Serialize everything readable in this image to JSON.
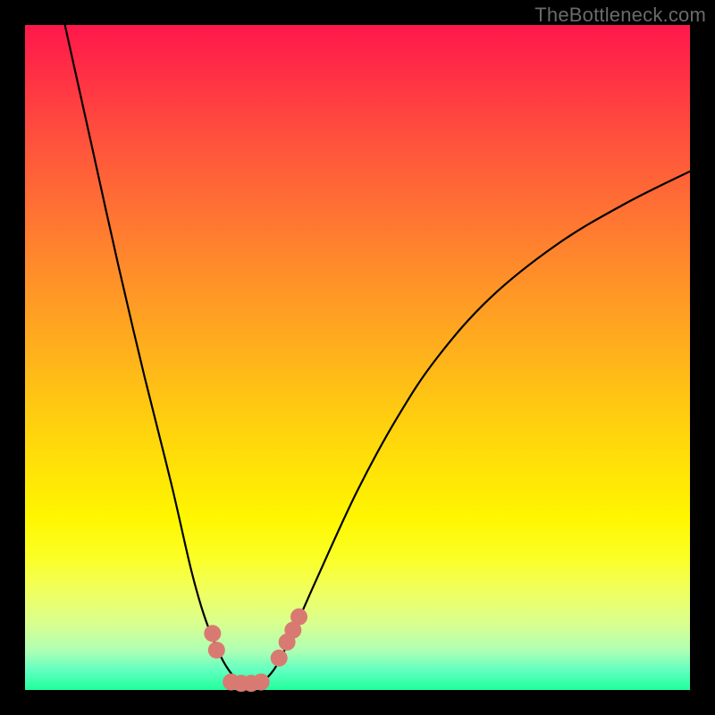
{
  "watermark": {
    "text": "TheBottleneck.com"
  },
  "colors": {
    "frame": "#000000",
    "curve": "#000000",
    "marker": "#d97a72",
    "gradient_top": "#ff184b",
    "gradient_bottom": "#21ff9c"
  },
  "chart_data": {
    "type": "line",
    "title": "",
    "xlabel": "",
    "ylabel": "",
    "xlim": [
      0,
      100
    ],
    "ylim": [
      0,
      100
    ],
    "x": [
      6,
      10,
      14,
      18,
      22,
      25,
      27,
      29,
      30,
      31,
      32,
      33,
      34,
      35,
      36,
      37,
      38,
      40,
      44,
      50,
      56,
      62,
      70,
      80,
      90,
      100
    ],
    "y": [
      100,
      82,
      64,
      47,
      31,
      18,
      11,
      6,
      4,
      2.5,
      1.5,
      1,
      1,
      1,
      1.5,
      2.5,
      4,
      8,
      17,
      30,
      41,
      50,
      59,
      67,
      73,
      78
    ],
    "series": [
      {
        "name": "bottleneck-curve",
        "x_key": "x",
        "y_key": "y"
      }
    ],
    "markers": {
      "name": "highlighted-points",
      "points": [
        {
          "x": 28.2,
          "y": 8.5
        },
        {
          "x": 28.8,
          "y": 6.0
        },
        {
          "x": 31.0,
          "y": 1.2
        },
        {
          "x": 32.5,
          "y": 1.0
        },
        {
          "x": 34.0,
          "y": 1.0
        },
        {
          "x": 35.5,
          "y": 1.2
        },
        {
          "x": 38.2,
          "y": 4.8
        },
        {
          "x": 39.4,
          "y": 7.2
        },
        {
          "x": 40.3,
          "y": 9.0
        },
        {
          "x": 41.2,
          "y": 11.0
        }
      ]
    }
  }
}
